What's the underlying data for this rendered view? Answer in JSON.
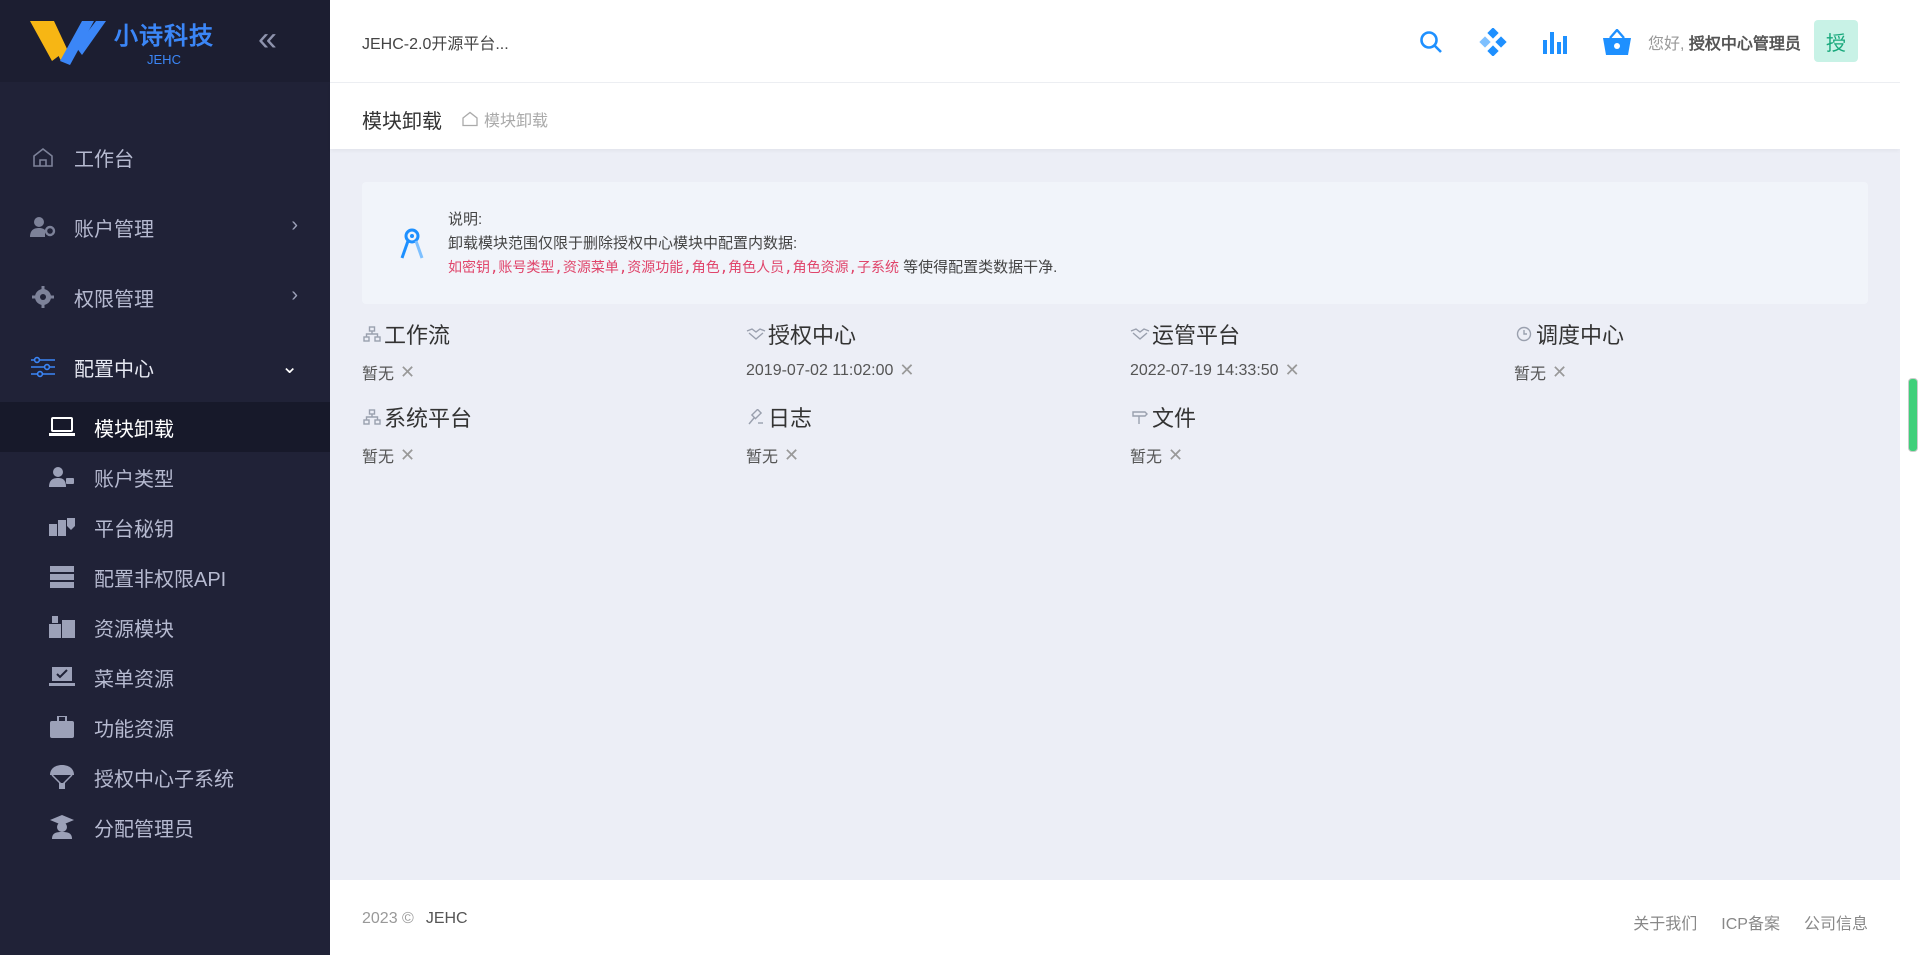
{
  "brand": {
    "title": "小诗科技",
    "sub": "JEHC",
    "collapse_icon": "double-chevron-left-icon"
  },
  "sidebar": {
    "menu": [
      {
        "label": "工作台",
        "icon": "home-icon",
        "has_arrow": false
      },
      {
        "label": "账户管理",
        "icon": "user-gear-icon",
        "has_arrow": true
      },
      {
        "label": "权限管理",
        "icon": "cog-icon",
        "has_arrow": true
      },
      {
        "label": "配置中心",
        "icon": "sliders-icon",
        "has_arrow": true,
        "open": true
      }
    ],
    "submenu": [
      {
        "label": "模块卸载",
        "icon": "laptop-icon",
        "active": true
      },
      {
        "label": "账户类型",
        "icon": "user-tag-icon"
      },
      {
        "label": "平台秘钥",
        "icon": "key-box-icon"
      },
      {
        "label": "配置非权限API",
        "icon": "server-icon"
      },
      {
        "label": "资源模块",
        "icon": "boxes-icon"
      },
      {
        "label": "菜单资源",
        "icon": "laptop-check-icon"
      },
      {
        "label": "功能资源",
        "icon": "briefcase-icon"
      },
      {
        "label": "授权中心子系统",
        "icon": "parachute-icon"
      },
      {
        "label": "分配管理员",
        "icon": "graduate-icon"
      }
    ]
  },
  "header": {
    "title": "JEHC-2.0开源平台...",
    "icons": [
      "search-icon",
      "diamond-grid-icon",
      "bar-chart-icon",
      "basket-icon"
    ],
    "greeting": "您好,",
    "user": "授权中心管理员",
    "avatar": "授"
  },
  "breadcrumb": {
    "title": "模块卸载",
    "path": "模块卸载"
  },
  "notice": {
    "line1": "说明:",
    "line2": "卸载模块范围仅限于删除授权中心模块中配置内数据:",
    "red": "如密钥,账号类型,资源菜单,资源功能,角色,角色人员,角色资源,子系统",
    "tail": "等使得配置类数据干净."
  },
  "modules": [
    {
      "name": "工作流",
      "value": "暂无",
      "icon": "sitemap-icon"
    },
    {
      "name": "授权中心",
      "value": "2019-07-02 11:02:00",
      "icon": "handshake-icon"
    },
    {
      "name": "运管平台",
      "value": "2022-07-19 14:33:50",
      "icon": "handshake-icon"
    },
    {
      "name": "调度中心",
      "value": "暂无",
      "icon": "clock-icon"
    },
    {
      "name": "系统平台",
      "value": "暂无",
      "icon": "sitemap-icon"
    },
    {
      "name": "日志",
      "value": "暂无",
      "icon": "gavel-icon"
    },
    {
      "name": "文件",
      "value": "暂无",
      "icon": "signpost-icon"
    }
  ],
  "footer": {
    "year": "2023 ©",
    "brand": "JEHC",
    "links": [
      "关于我们",
      "ICP备案",
      "公司信息"
    ]
  }
}
